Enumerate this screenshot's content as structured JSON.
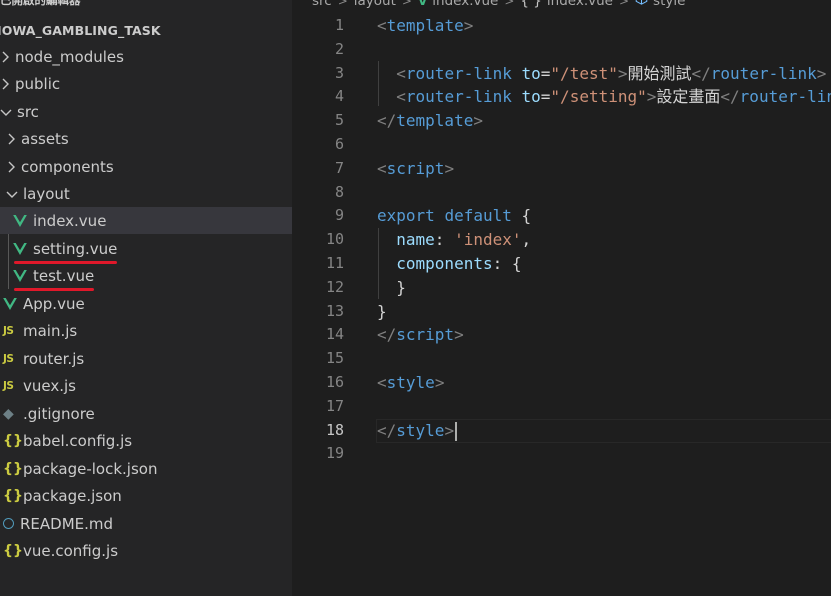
{
  "colors": {
    "sidebar_bg": "#252526",
    "editor_bg": "#1e1e1e",
    "selection_bg": "#37373d",
    "vue_green": "#41b883",
    "js_yellow": "#cbcb41",
    "annotation_red": "#e0182a"
  },
  "sidebar": {
    "section_title": "已開啟的編輯器",
    "project_title": "IOWA_GAMBLING_TASK",
    "items": [
      {
        "label": "node_modules",
        "icon": "chevron-right-icon"
      },
      {
        "label": "public",
        "icon": "chevron-right-icon"
      },
      {
        "label": "src",
        "icon": "chevron-down-icon"
      },
      {
        "label": "assets",
        "icon": "chevron-right-icon"
      },
      {
        "label": "components",
        "icon": "chevron-right-icon"
      },
      {
        "label": "layout",
        "icon": "chevron-down-icon"
      },
      {
        "label": "index.vue",
        "icon": "vue-file-icon",
        "selected": true
      },
      {
        "label": "setting.vue",
        "icon": "vue-file-icon",
        "annotated": true
      },
      {
        "label": "test.vue",
        "icon": "vue-file-icon",
        "annotated": true
      },
      {
        "label": "App.vue",
        "icon": "vue-file-icon"
      },
      {
        "label": "main.js",
        "icon": "js-file-icon",
        "icon_text": "JS"
      },
      {
        "label": "router.js",
        "icon": "js-file-icon",
        "icon_text": "JS"
      },
      {
        "label": "vuex.js",
        "icon": "js-file-icon",
        "icon_text": "JS"
      },
      {
        "label": ".gitignore",
        "icon": "git-file-icon",
        "icon_text": "◆"
      },
      {
        "label": "babel.config.js",
        "icon": "json-file-icon",
        "icon_text": "{}"
      },
      {
        "label": "package-lock.json",
        "icon": "json-file-icon",
        "icon_text": "{}"
      },
      {
        "label": "package.json",
        "icon": "json-file-icon",
        "icon_text": "{}"
      },
      {
        "label": "README.md",
        "icon": "info-file-icon"
      },
      {
        "label": "vue.config.js",
        "icon": "json-file-icon",
        "icon_text": "{}"
      }
    ]
  },
  "breadcrumbs": {
    "parts": [
      "src",
      "layout",
      "index.vue",
      "{ }",
      "index.vue",
      "style"
    ],
    "separator": ">",
    "vue_glyph": "V"
  },
  "editor": {
    "line_numbers": [
      "1",
      "2",
      "3",
      "4",
      "5",
      "6",
      "7",
      "8",
      "9",
      "10",
      "11",
      "12",
      "13",
      "14",
      "15",
      "16",
      "17",
      "18",
      "19"
    ],
    "active_line": "18",
    "lines": [
      [
        {
          "t": "t-punc",
          "v": "<"
        },
        {
          "t": "t-tag",
          "v": "template"
        },
        {
          "t": "t-punc",
          "v": ">"
        }
      ],
      [],
      [
        {
          "t": "t-plain",
          "v": "  "
        },
        {
          "t": "t-punc",
          "v": "<"
        },
        {
          "t": "t-tag",
          "v": "router-link"
        },
        {
          "t": "t-plain",
          "v": " "
        },
        {
          "t": "t-attr",
          "v": "to"
        },
        {
          "t": "t-eq",
          "v": "="
        },
        {
          "t": "t-str",
          "v": "\"/test\""
        },
        {
          "t": "t-punc",
          "v": ">"
        },
        {
          "t": "t-text",
          "v": "開始測試"
        },
        {
          "t": "t-punc",
          "v": "</"
        },
        {
          "t": "t-tag",
          "v": "router-link"
        },
        {
          "t": "t-punc",
          "v": ">"
        }
      ],
      [
        {
          "t": "t-plain",
          "v": "  "
        },
        {
          "t": "t-punc",
          "v": "<"
        },
        {
          "t": "t-tag",
          "v": "router-link"
        },
        {
          "t": "t-plain",
          "v": " "
        },
        {
          "t": "t-attr",
          "v": "to"
        },
        {
          "t": "t-eq",
          "v": "="
        },
        {
          "t": "t-str",
          "v": "\"/setting\""
        },
        {
          "t": "t-punc",
          "v": ">"
        },
        {
          "t": "t-text",
          "v": "設定畫面"
        },
        {
          "t": "t-punc",
          "v": "</"
        },
        {
          "t": "t-tag",
          "v": "router-link"
        },
        {
          "t": "t-punc",
          "v": ">"
        }
      ],
      [
        {
          "t": "t-punc",
          "v": "</"
        },
        {
          "t": "t-tag",
          "v": "template"
        },
        {
          "t": "t-punc",
          "v": ">"
        }
      ],
      [],
      [
        {
          "t": "t-punc",
          "v": "<"
        },
        {
          "t": "t-tag",
          "v": "script"
        },
        {
          "t": "t-punc",
          "v": ">"
        }
      ],
      [],
      [
        {
          "t": "t-kw",
          "v": "export"
        },
        {
          "t": "t-plain",
          "v": " "
        },
        {
          "t": "t-kw",
          "v": "default"
        },
        {
          "t": "t-plain",
          "v": " {"
        }
      ],
      [
        {
          "t": "t-plain",
          "v": "  "
        },
        {
          "t": "t-prop",
          "v": "name"
        },
        {
          "t": "t-plain",
          "v": ": "
        },
        {
          "t": "t-str",
          "v": "'index'"
        },
        {
          "t": "t-plain",
          "v": ","
        }
      ],
      [
        {
          "t": "t-plain",
          "v": "  "
        },
        {
          "t": "t-prop",
          "v": "components"
        },
        {
          "t": "t-plain",
          "v": ": {"
        }
      ],
      [
        {
          "t": "t-plain",
          "v": "  }"
        }
      ],
      [
        {
          "t": "t-plain",
          "v": "}"
        }
      ],
      [
        {
          "t": "t-punc",
          "v": "</"
        },
        {
          "t": "t-tag",
          "v": "script"
        },
        {
          "t": "t-punc",
          "v": ">"
        }
      ],
      [],
      [
        {
          "t": "t-punc",
          "v": "<"
        },
        {
          "t": "t-tag",
          "v": "style"
        },
        {
          "t": "t-punc",
          "v": ">"
        }
      ],
      [],
      [
        {
          "t": "t-punc",
          "v": "</"
        },
        {
          "t": "t-tag",
          "v": "style"
        },
        {
          "t": "t-punc",
          "v": ">"
        }
      ],
      []
    ]
  }
}
